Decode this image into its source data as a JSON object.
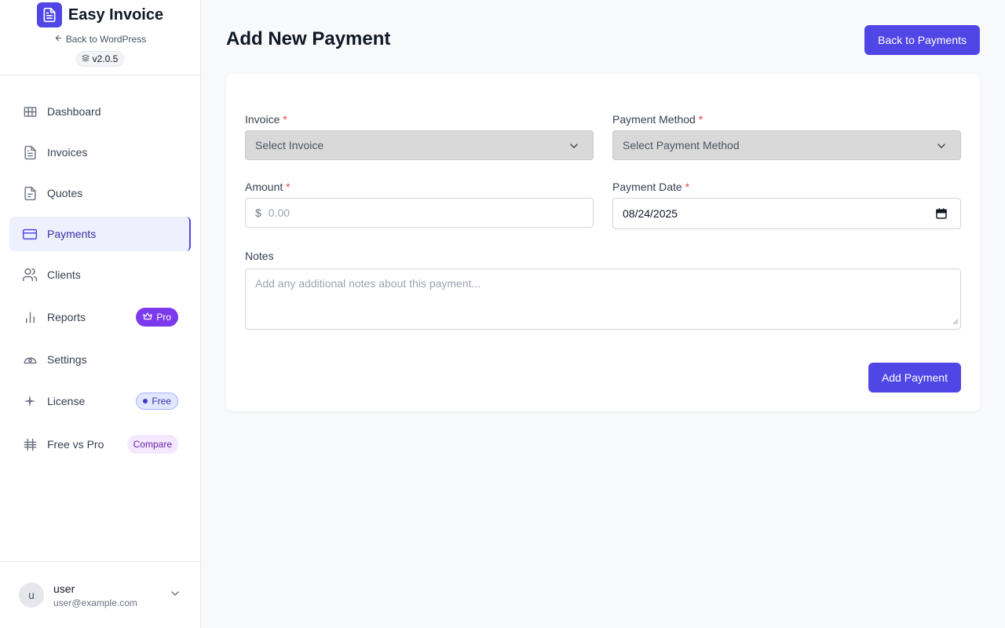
{
  "brand": {
    "name": "Easy Invoice",
    "back_link": "Back to WordPress",
    "version": "v2.0.5"
  },
  "nav": {
    "items": [
      {
        "label": "Dashboard",
        "icon": "grid-icon",
        "active": false
      },
      {
        "label": "Invoices",
        "icon": "file-text-icon",
        "active": false
      },
      {
        "label": "Quotes",
        "icon": "file-text-icon",
        "active": false
      },
      {
        "label": "Payments",
        "icon": "credit-card-icon",
        "active": true
      },
      {
        "label": "Clients",
        "icon": "users-icon",
        "active": false
      },
      {
        "label": "Reports",
        "icon": "bar-chart-icon",
        "active": false,
        "badge": "Pro"
      },
      {
        "label": "Settings",
        "icon": "gauge-icon",
        "active": false
      },
      {
        "label": "License",
        "icon": "sparkle-icon",
        "active": false,
        "badge": "Free"
      },
      {
        "label": "Free vs Pro",
        "icon": "hash-icon",
        "active": false,
        "badge": "Compare"
      }
    ]
  },
  "user": {
    "initial": "u",
    "name": "user",
    "email": "user@example.com"
  },
  "page": {
    "title": "Add New Payment",
    "back_button": "Back to Payments"
  },
  "form": {
    "invoice": {
      "label": "Invoice",
      "required_mark": "*",
      "value": "Select Invoice"
    },
    "payment_method": {
      "label": "Payment Method",
      "required_mark": "*",
      "value": "Select Payment Method"
    },
    "amount": {
      "label": "Amount",
      "required_mark": "*",
      "currency": "$",
      "placeholder": "0.00"
    },
    "payment_date": {
      "label": "Payment Date",
      "required_mark": "*",
      "value": "08/24/2025"
    },
    "notes": {
      "label": "Notes",
      "placeholder": "Add any additional notes about this payment..."
    },
    "submit_label": "Add Payment"
  },
  "colors": {
    "accent": "#4f46e5",
    "pro_badge": "#7c3aed",
    "required": "#ef4444"
  }
}
